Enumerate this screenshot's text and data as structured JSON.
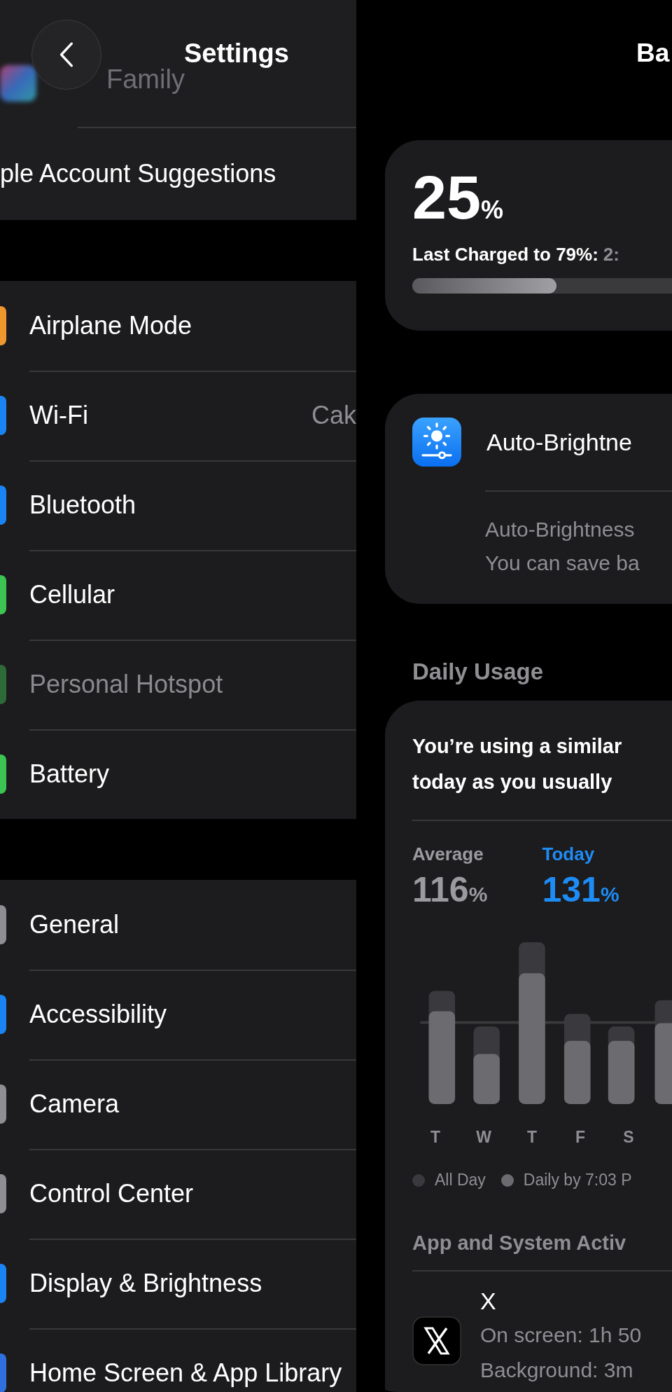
{
  "settings": {
    "title": "Settings",
    "groups": [
      {
        "rows": [
          {
            "label": "Family",
            "kind": "blurred"
          },
          {
            "label": "ple Account Suggestions",
            "kind": "text"
          }
        ]
      },
      {
        "rows": [
          {
            "label": "Airplane Mode",
            "kind": "icon",
            "color": "#f0962f",
            "disabled": false
          },
          {
            "label": "Wi-Fi",
            "kind": "icon",
            "color": "#1b84f5",
            "value": "Cak",
            "disabled": false
          },
          {
            "label": "Bluetooth",
            "kind": "icon",
            "color": "#1b84f5",
            "disabled": false
          },
          {
            "label": "Cellular",
            "kind": "icon",
            "color": "#3cc552",
            "disabled": false
          },
          {
            "label": "Personal Hotspot",
            "kind": "icon",
            "color": "#2e6a38",
            "disabled": true
          },
          {
            "label": "Battery",
            "kind": "icon",
            "color": "#3cc552",
            "disabled": false
          }
        ]
      },
      {
        "rows": [
          {
            "label": "General",
            "kind": "icon",
            "color": "#8e8e93",
            "disabled": false
          },
          {
            "label": "Accessibility",
            "kind": "icon",
            "color": "#1b84f5",
            "disabled": false
          },
          {
            "label": "Camera",
            "kind": "icon",
            "color": "#8e8e93",
            "disabled": false
          },
          {
            "label": "Control Center",
            "kind": "icon",
            "color": "#8e8e93",
            "disabled": false
          },
          {
            "label": "Display & Brightness",
            "kind": "icon",
            "color": "#1b84f5",
            "disabled": false
          },
          {
            "label": "Home Screen & App Library",
            "kind": "icon",
            "color": "#2f6fe0",
            "disabled": false
          }
        ]
      }
    ]
  },
  "battery": {
    "title": "Ba",
    "charge": {
      "percent": "25",
      "unit": "%",
      "last_charged": "Last Charged to 79%:",
      "time": "2:",
      "level": 0.555
    },
    "brightness": {
      "title": "Auto-Brightne",
      "lines": [
        "Auto-Brightness",
        "You can save ba"
      ]
    },
    "daily_usage": {
      "header": "Daily Usage",
      "summary": [
        "You’re using a similar",
        "today as you usually"
      ],
      "stats": [
        {
          "label": "Average",
          "value": "116",
          "unit": "%",
          "color": "#9a9a9f"
        },
        {
          "label": "Today",
          "value": "131",
          "unit": "%",
          "color": "#1e8cf5"
        }
      ],
      "day_labels": [
        "T",
        "W",
        "T",
        "F",
        "S"
      ],
      "legend": [
        {
          "label": "All Day",
          "color": "#3a3a3e"
        },
        {
          "label": "Daily by 7:03 P",
          "color": "#6c6c70"
        }
      ],
      "activity_header": "App and System Activ",
      "apps": [
        {
          "name": "X",
          "lines": [
            "On screen: 1h 50",
            "Background: 3m"
          ]
        }
      ]
    }
  }
}
